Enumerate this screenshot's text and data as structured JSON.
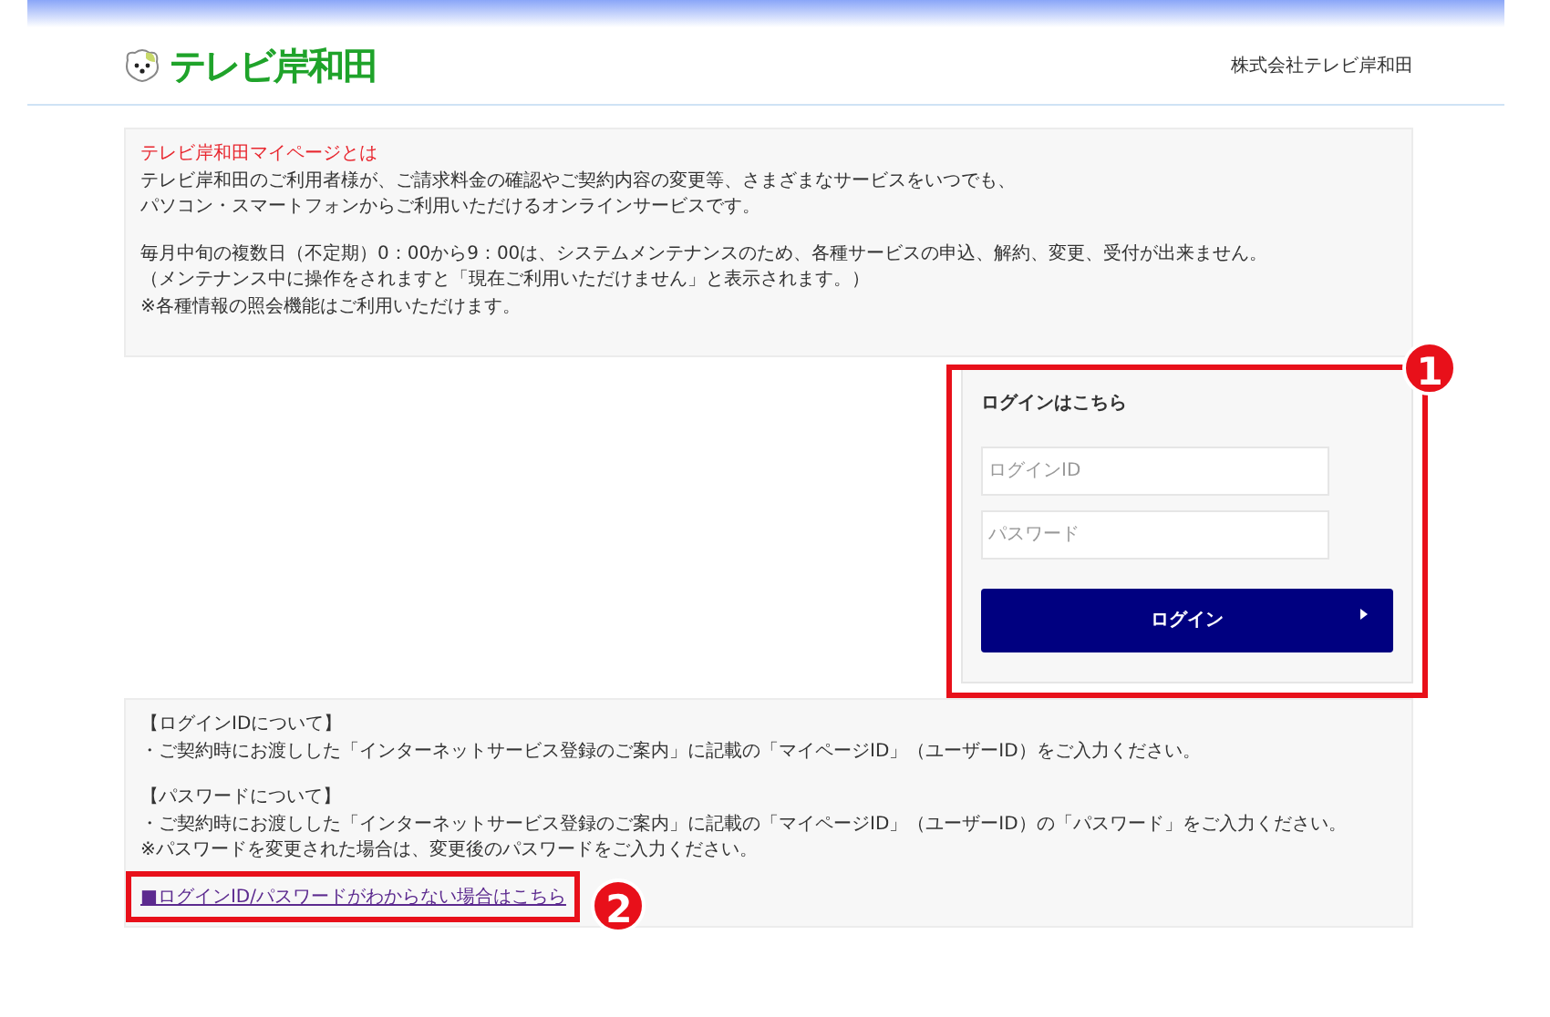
{
  "header": {
    "logo_text": "テレビ岸和田",
    "company": "株式会社テレビ岸和田"
  },
  "intro": {
    "title": "テレビ岸和田マイページとは",
    "paragraphs": [
      [
        "テレビ岸和田のご利用者様が、ご請求料金の確認やご契約内容の変更等、さまざまなサービスをいつでも、",
        "パソコン・スマートフォンからご利用いただけるオンラインサービスです。"
      ],
      [
        "毎月中旬の複数日（不定期）0：00から9：00は、システムメンテナンスのため、各種サービスの申込、解約、変更、受付が出来ません。",
        "（メンテナンス中に操作をされますと「現在ご利用いただけません」と表示されます。）",
        "※各種情報の照会機能はご利用いただけます。"
      ]
    ]
  },
  "login": {
    "heading": "ログインはこちら",
    "fields": [
      {
        "placeholder": "ログインID"
      },
      {
        "placeholder": "パスワード"
      }
    ],
    "button": "ログイン"
  },
  "notes": {
    "paragraphs": [
      [
        "【ログインIDについて】",
        "・ご契約時にお渡しした「インターネットサービス登録のご案内」に記載の「マイページID」（ユーザーID）をご入力ください。"
      ],
      [
        "【パスワードについて】",
        "・ご契約時にお渡しした「インターネットサービス登録のご案内」に記載の「マイページID」（ユーザーID）の「パスワード」をご入力ください。",
        "※パスワードを変更された場合は、変更後のパスワードをご入力ください。"
      ]
    ],
    "help_link": "■ログインID/パスワードがわからない場合はこちら"
  },
  "annotations": [
    {
      "number": "1"
    },
    {
      "number": "2"
    }
  ]
}
